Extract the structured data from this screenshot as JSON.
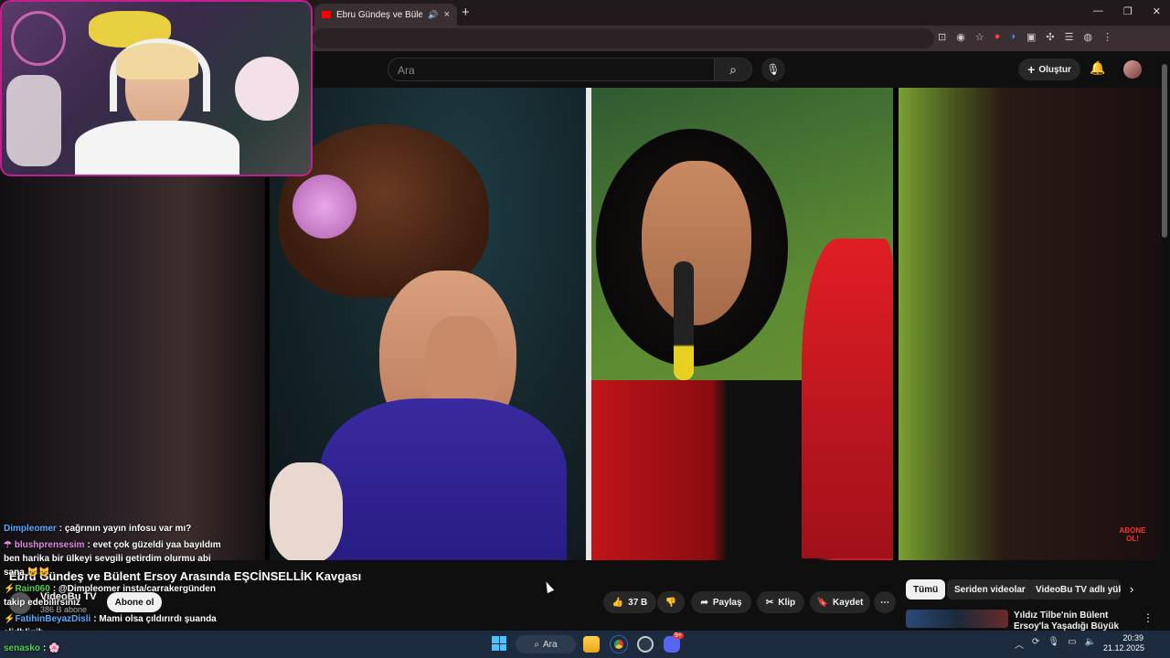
{
  "browser": {
    "tab_title": "Ebru Gündeş ve Bülent Ersoy",
    "tab_close": "×",
    "new_tab": "+",
    "window_controls": [
      "—",
      "❐",
      "✕"
    ]
  },
  "youtube": {
    "search_placeholder": "Ara",
    "create_label": "Oluştur",
    "video_title": "Ebru Gündeş ve Bülent Ersoy Arasında EŞCİNSELLİK Kavgası",
    "channel_name": "VideoBu TV",
    "subscribers": "386 B abone",
    "subscribe_label": "Abone ol",
    "likes": "37 B",
    "share_label": "Paylaş",
    "clip_label": "Klip",
    "save_label": "Kaydet",
    "more_label": "⋯",
    "chips": [
      "Tümü",
      "Seriden videolar",
      "VideoBu TV adlı yükle"
    ],
    "rec_title": "Yıldız Tilbe'nin Bülent Ersoy'la Yaşadığı Büyük Kavgal (",
    "overlay_badge": "ABONE OL!"
  },
  "chat": [
    {
      "name": "Dimpleomer",
      "name_color": "#5aa9ff",
      "text": ": çağrının yayın infosu var mı?"
    },
    {
      "name": "blushprensesim",
      "name_color": "#e08ae0",
      "text": ": evet çok güzeldi yaa bayıldım"
    },
    {
      "name": "",
      "name_color": "#ffffff",
      "text": "ben harika bir ülkeyi sevgili getirdim olurmu abi"
    },
    {
      "name": "",
      "name_color": "#ffffff",
      "text": "sana"
    },
    {
      "name": "Rain060",
      "name_color": "#4fd34f",
      "text": ": @Dimpleomer insta/carrakergünden"
    },
    {
      "name": "",
      "name_color": "#ffffff",
      "text": "takip edebilirsiniz"
    },
    {
      "name": "FatihinBeyazDisli",
      "name_color": "#5aa9ff",
      "text": ": Mami olsa çıldırırdı şuanda"
    },
    {
      "name": "",
      "name_color": "#ffffff",
      "text": "sljdhljgjh"
    },
    {
      "name": "senasko",
      "name_color": "#4fd34f",
      "text": ":"
    }
  ],
  "taskbar": {
    "search_label": "Ara",
    "time": "20:39",
    "date": "21.12.2025",
    "discord_badge": "9+"
  },
  "colors": {
    "youtube_red": "#ff0000",
    "webcam_border": "#c21f8f",
    "taskbar_bg": "#1c2b3e"
  }
}
